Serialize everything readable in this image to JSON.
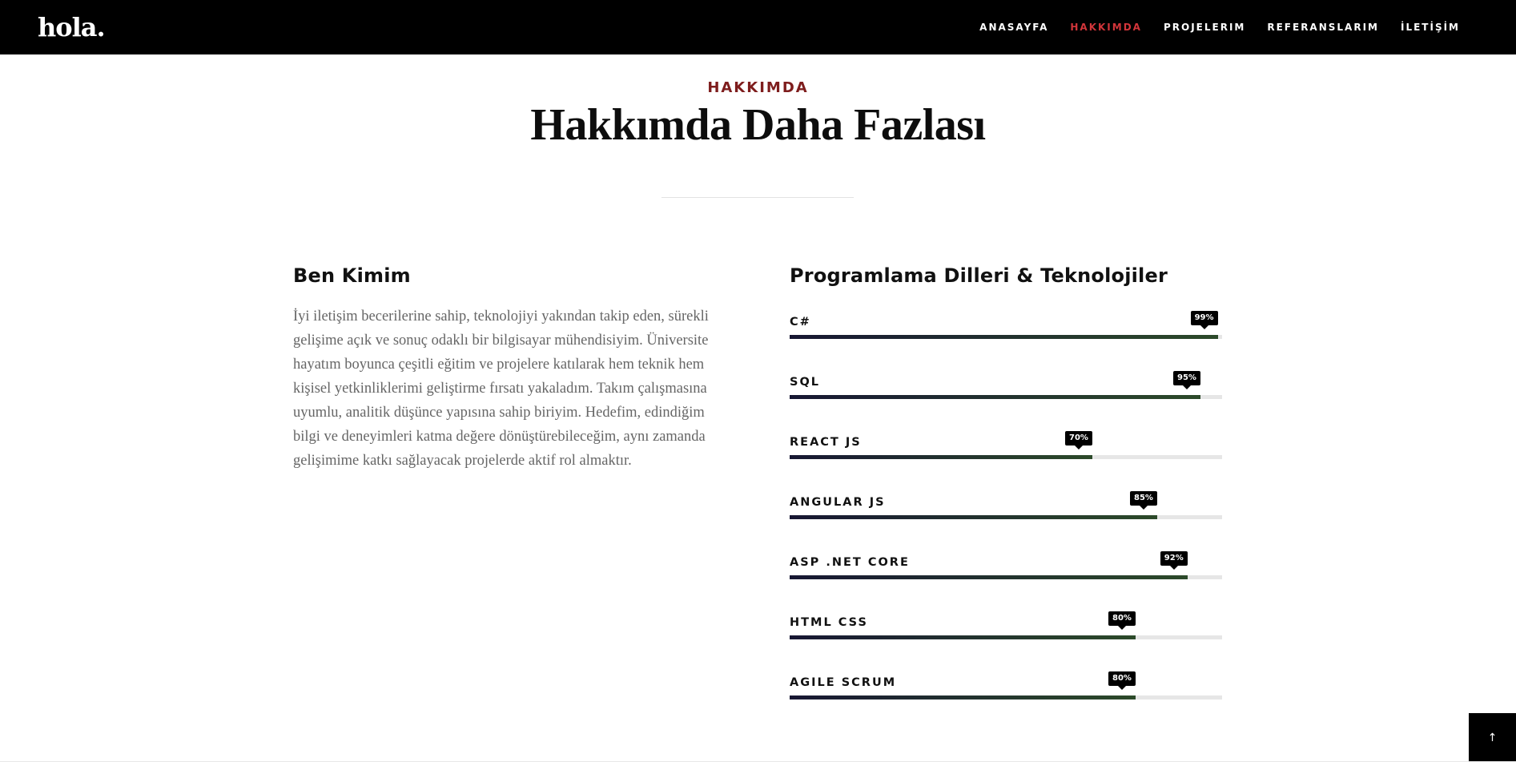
{
  "header": {
    "logo": "hola.",
    "nav": [
      {
        "label": "ANASAYFA",
        "active": false
      },
      {
        "label": "HAKKIMDA",
        "active": true
      },
      {
        "label": "PROJELERIM",
        "active": false
      },
      {
        "label": "REFERANSLARIM",
        "active": false
      },
      {
        "label": "İLETİŞİM",
        "active": false
      }
    ],
    "active_color": "#d2353a"
  },
  "section": {
    "eyebrow": "HAKKIMDA",
    "title": "Hakkımda Daha Fazlası"
  },
  "about": {
    "heading": "Ben Kimim",
    "text": "İyi iletişim becerilerine sahip, teknolojiyi yakından takip eden, sürekli gelişime açık ve sonuç odaklı bir bilgisayar mühendisiyim. Üniversite hayatım boyunca çeşitli eğitim ve projelere katılarak hem teknik hem kişisel yetkinliklerimi geliştirme fırsatı yakaladım. Takım çalışmasına uyumlu, analitik düşünce yapısına sahip biriyim. Hedefim, edindiğim bilgi ve deneyimleri katma değere dönüştürebileceğim, aynı zamanda gelişimime katkı sağlayacak projelerde aktif rol almaktır."
  },
  "skills": {
    "heading": "Programlama Dilleri & Teknolojiler",
    "items": [
      {
        "name": "C#",
        "percent": 99,
        "label": "99%"
      },
      {
        "name": "SQL",
        "percent": 95,
        "label": "95%"
      },
      {
        "name": "REACT JS",
        "percent": 70,
        "label": "70%"
      },
      {
        "name": "ANGULAR JS",
        "percent": 85,
        "label": "85%"
      },
      {
        "name": "ASP .NET CORE",
        "percent": 92,
        "label": "92%"
      },
      {
        "name": "HTML CSS",
        "percent": 80,
        "label": "80%"
      },
      {
        "name": "AGILE SCRUM",
        "percent": 80,
        "label": "80%"
      }
    ]
  },
  "scroll_top": {
    "icon": "arrow-up-icon",
    "glyph": "↑"
  }
}
